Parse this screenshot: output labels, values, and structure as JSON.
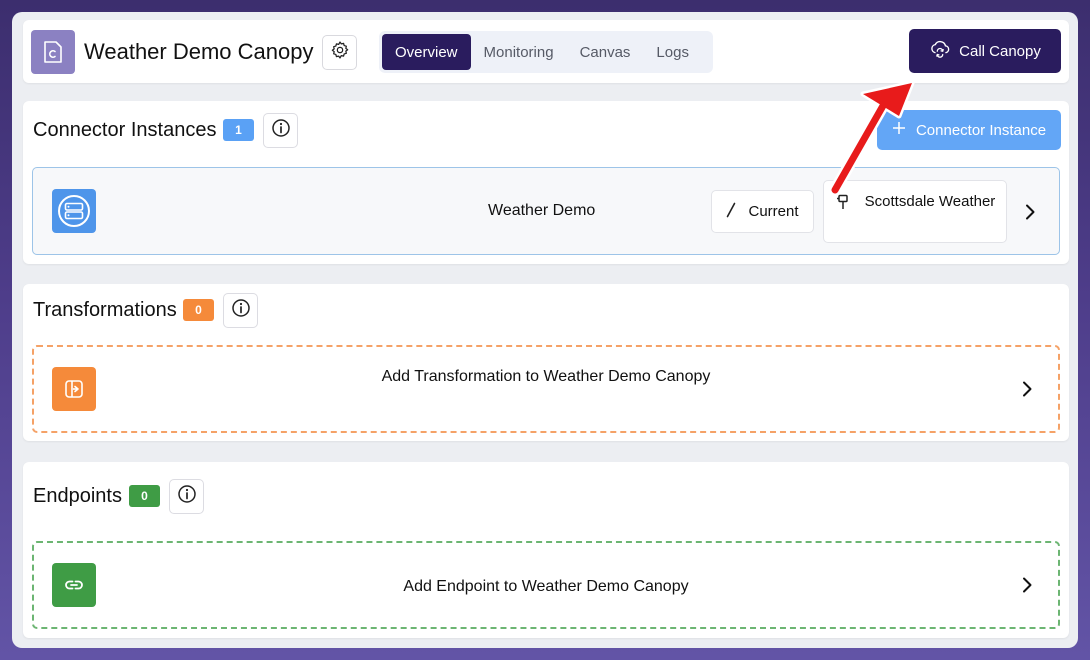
{
  "header": {
    "title": "Weather Demo Canopy",
    "tabs": [
      {
        "label": "Overview",
        "active": true
      },
      {
        "label": "Monitoring",
        "active": false
      },
      {
        "label": "Canvas",
        "active": false
      },
      {
        "label": "Logs",
        "active": false
      }
    ],
    "call_button_label": "Call Canopy"
  },
  "connectors": {
    "title": "Connector Instances",
    "count": "1",
    "add_button_label": "Connector Instance",
    "row": {
      "name": "Weather Demo",
      "version_label": "Current",
      "environment_label": "Scottsdale Weather"
    }
  },
  "transformations": {
    "title": "Transformations",
    "count": "0",
    "add_label": "Add Transformation to Weather Demo Canopy"
  },
  "endpoints": {
    "title": "Endpoints",
    "count": "0",
    "add_label": "Add Endpoint to Weather Demo Canopy"
  },
  "colors": {
    "primary": "#2a1c5e",
    "connector": "#4e95ea",
    "add_connector_button": "#63a6f6",
    "transformation": "#f58a3a",
    "endpoint": "#3f9c45",
    "annotation_arrow": "#e81b1b"
  },
  "icons": {
    "logo": "canopy-logo-icon",
    "settings": "gear-icon",
    "call": "cloud-sync-icon",
    "info": "info-icon",
    "add": "plus-icon",
    "connector": "server-icon",
    "version": "slash-icon",
    "environment": "pin-icon",
    "transformation": "transform-icon",
    "endpoint": "link-icon",
    "next": "chevron-right-icon"
  }
}
